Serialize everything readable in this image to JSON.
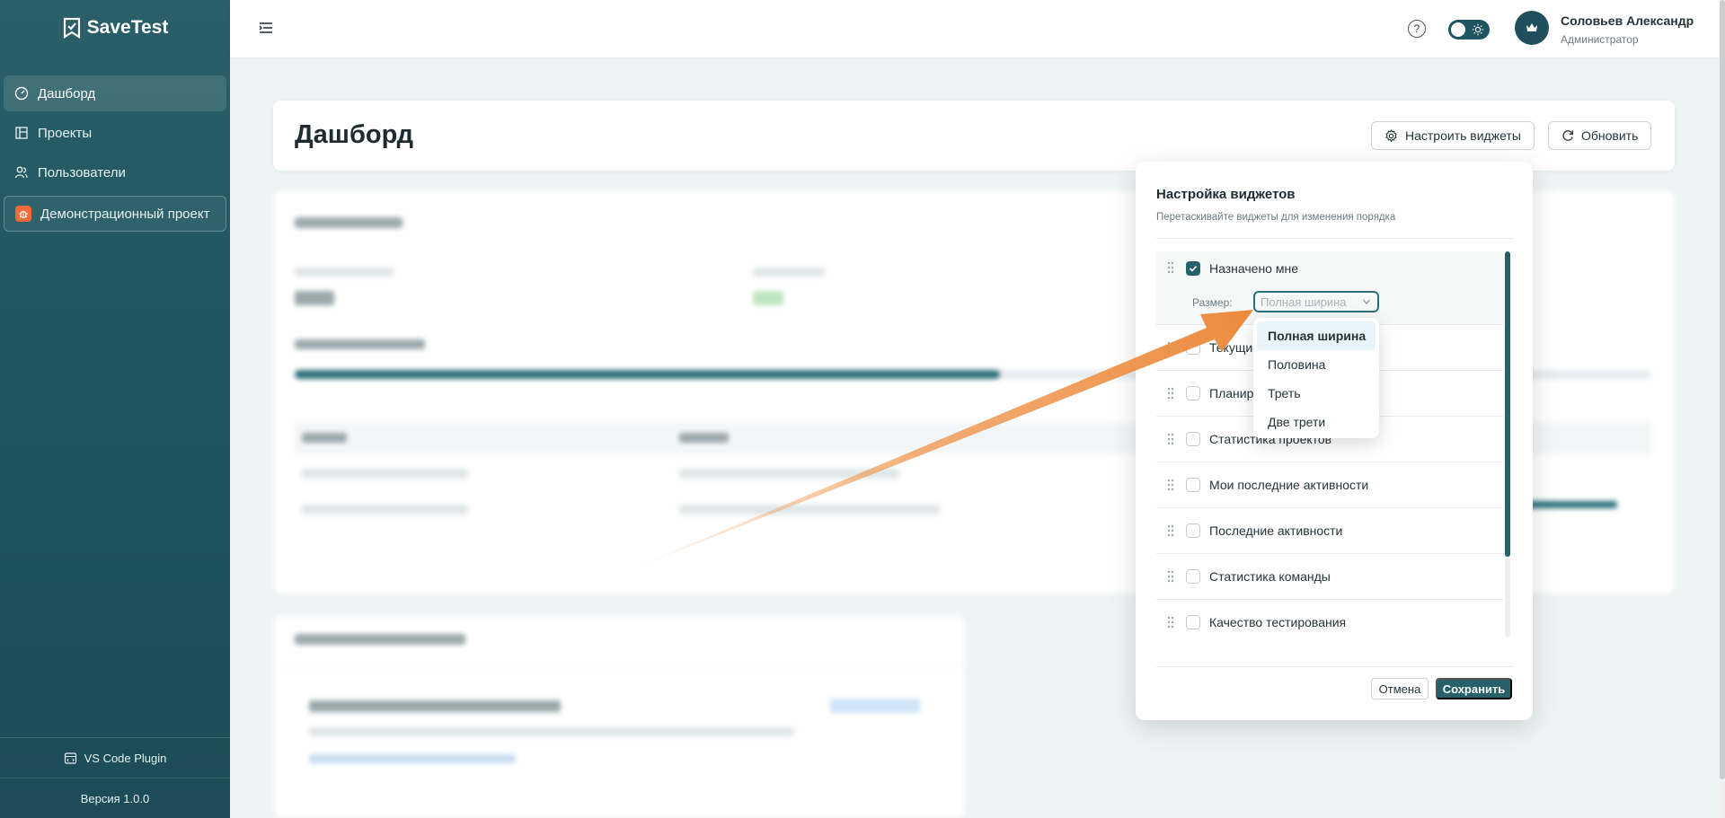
{
  "app": {
    "name": "SaveTest"
  },
  "sidebar": {
    "items": [
      {
        "label": "Дашборд",
        "icon": "dashboard-icon",
        "active": true
      },
      {
        "label": "Проекты",
        "icon": "projects-icon"
      },
      {
        "label": "Пользователи",
        "icon": "users-icon"
      }
    ],
    "project": {
      "label": "Демонстрационный проект",
      "icon": "bug-icon"
    },
    "plugin_label": "VS Code Plugin",
    "version_label": "Версия 1.0.0"
  },
  "header": {
    "help_symbol": "?",
    "user_name": "Соловьев Александр",
    "user_role": "Администратор"
  },
  "main": {
    "page_title": "Дашборд",
    "configure_label": "Настроить виджеты",
    "refresh_label": "Обновить"
  },
  "popover": {
    "title": "Настройка виджетов",
    "subtitle": "Перетаскивайте виджеты для изменения порядка",
    "widgets": [
      {
        "label": "Назначено мне",
        "checked": true
      },
      {
        "label": "Текущие",
        "checked": false
      },
      {
        "label": "Планиру",
        "checked": false
      },
      {
        "label": "Статистика проектов",
        "checked": false
      },
      {
        "label": "Мои последние активности",
        "checked": false
      },
      {
        "label": "Последние активности",
        "checked": false
      },
      {
        "label": "Статистика команды",
        "checked": false
      },
      {
        "label": "Качество тестирования",
        "checked": false
      }
    ],
    "size_label": "Размер:",
    "size_placeholder": "Полная ширина",
    "size_options": [
      "Полная ширина",
      "Половина",
      "Треть",
      "Две трети"
    ],
    "cancel_label": "Отмена",
    "save_label": "Сохранить"
  },
  "colors": {
    "primary": "#25606b",
    "sidebar": "#1f5560",
    "accent_arrow": "#f0954c",
    "project_badge": "#f06a3a"
  }
}
